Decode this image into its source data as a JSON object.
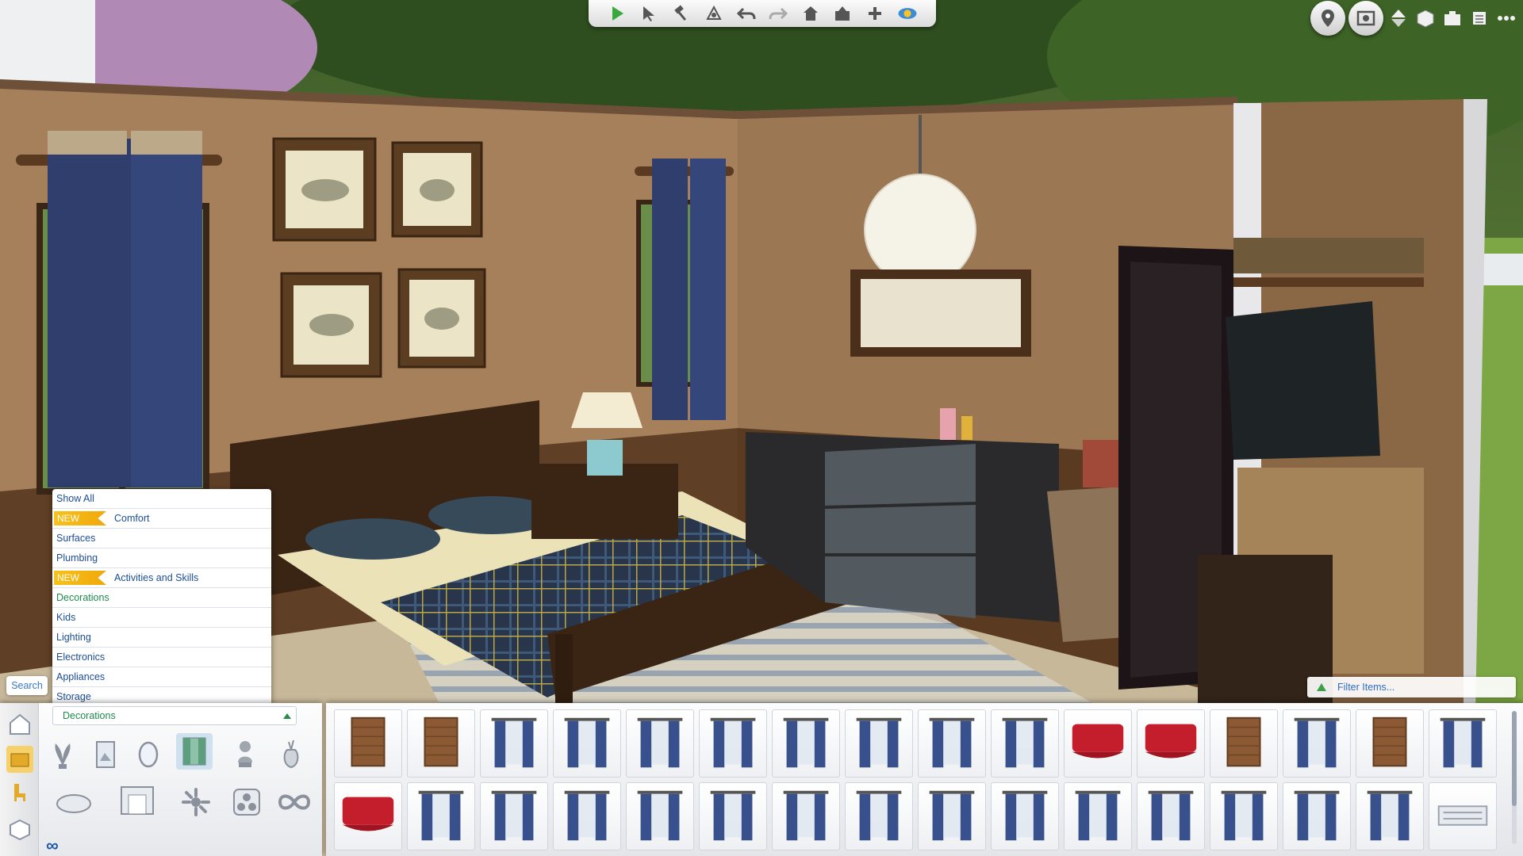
{
  "toolbar": {
    "buttons": [
      "play-icon",
      "select-icon",
      "sledgehammer-icon",
      "design-tool-icon",
      "undo-icon",
      "redo-icon",
      "house-icon",
      "lot-icon",
      "add-icon",
      "eye-toggle-icon"
    ]
  },
  "top_right": {
    "buttons": [
      "map-pin-icon",
      "camera-icon",
      "level-up-icon",
      "cube-icon",
      "camera-mode-icon",
      "list-icon",
      "more-icon"
    ]
  },
  "category_menu": {
    "items": [
      {
        "label": "Show  All",
        "badge": ""
      },
      {
        "label": "Comfort",
        "badge": "NEW"
      },
      {
        "label": "Surfaces",
        "badge": ""
      },
      {
        "label": "Plumbing",
        "badge": ""
      },
      {
        "label": "Activities  and  Skills",
        "badge": "NEW"
      },
      {
        "label": "Decorations",
        "badge": "",
        "selected": true
      },
      {
        "label": "Kids",
        "badge": ""
      },
      {
        "label": "Lighting",
        "badge": ""
      },
      {
        "label": "Electronics",
        "badge": ""
      },
      {
        "label": "Appliances",
        "badge": ""
      },
      {
        "label": "Storage",
        "badge": ""
      }
    ]
  },
  "search": {
    "label": "Search"
  },
  "category_dropdown": {
    "selected": "Decorations"
  },
  "filter": {
    "placeholder": "Filter Items..."
  },
  "left_column": {
    "icons": [
      "house-icon",
      "room-icon",
      "chair-icon",
      "box-icon"
    ]
  },
  "subcategories": {
    "row1": [
      "plant-icon",
      "wall-art-icon",
      "mirror-icon",
      "window-dressing-icon",
      "statue-icon",
      "vase-icon"
    ],
    "row2": [
      "rug-icon",
      "fireplace-icon",
      "clutter-icon",
      "misc-icon",
      "infinity-icon"
    ]
  },
  "footer": {
    "infinity_symbol": "∞"
  },
  "items": {
    "row1": [
      "blinds",
      "blinds",
      "curtain",
      "curtain",
      "curtain",
      "curtain",
      "curtain",
      "curtain",
      "curtain",
      "curtain",
      "valance",
      "valance",
      "blinds",
      "curtain",
      "blinds",
      "curtain"
    ],
    "row2": [
      "valance",
      "curtain",
      "curtain",
      "curtain",
      "curtain",
      "curtain",
      "curtain",
      "curtain",
      "curtain",
      "curtain",
      "curtain",
      "curtain",
      "curtain",
      "curtain",
      "curtain",
      "vent"
    ]
  },
  "colors": {
    "wall": "#a5805a",
    "wainscot": "#5f3f25",
    "grass": "#6d8f3a",
    "accent_blue": "#1d4d96",
    "accent_green": "#1f8a4c",
    "new_badge": "#f5b716"
  }
}
